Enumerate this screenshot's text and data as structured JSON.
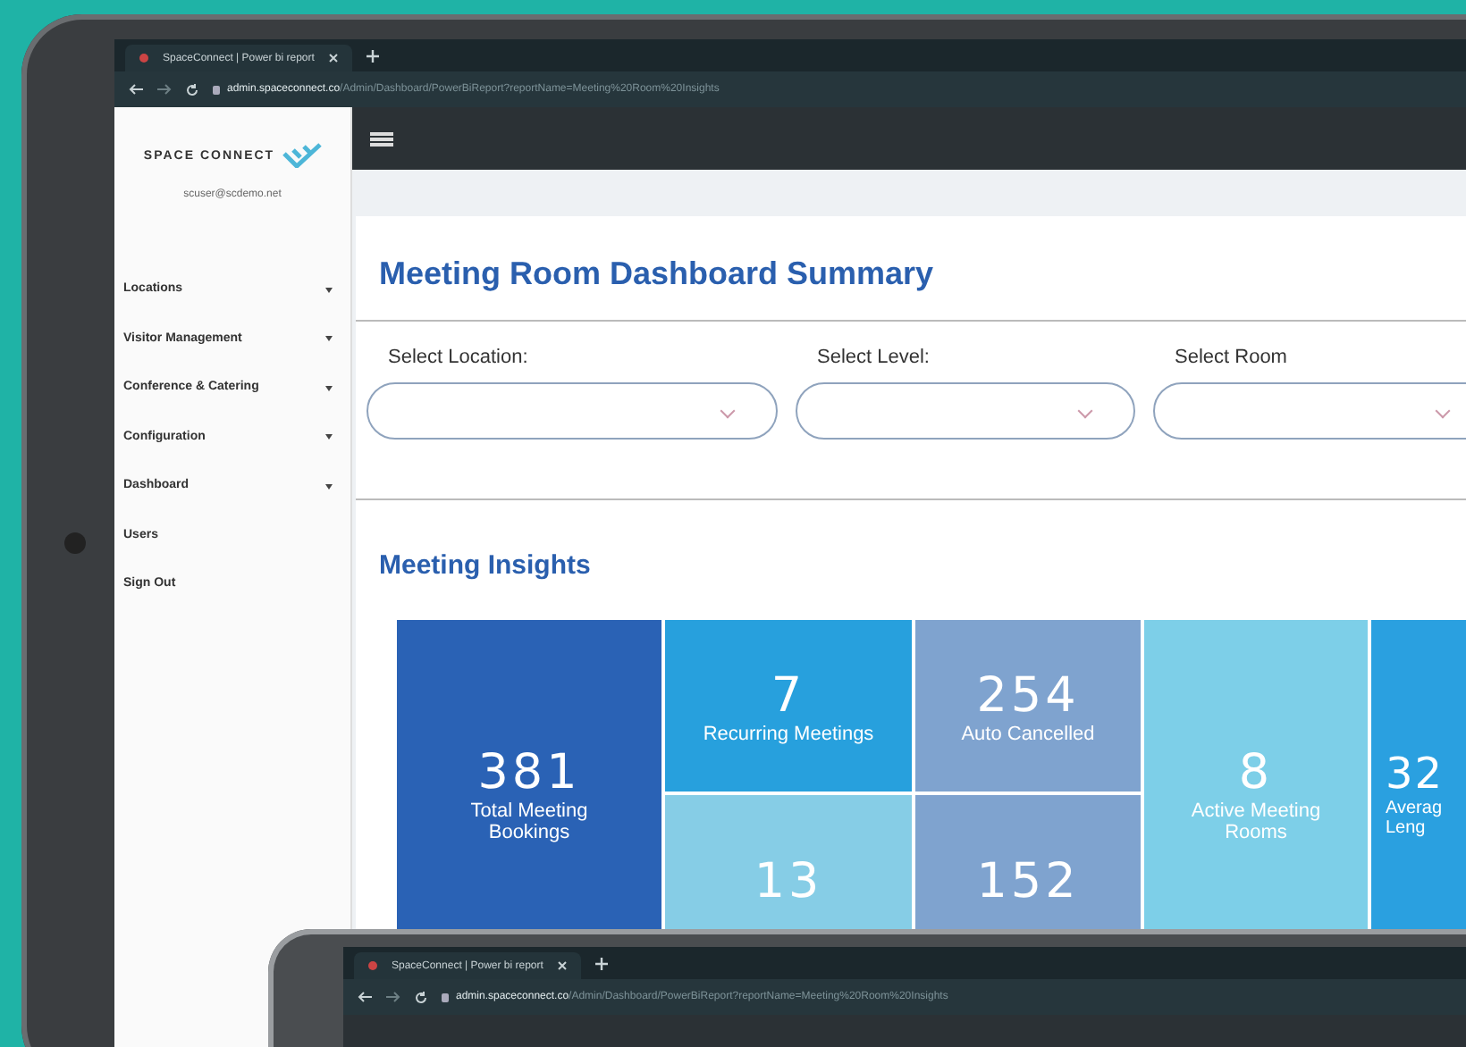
{
  "browser": {
    "tab_title": "SpaceConnect | Power bi report",
    "url_host": "admin.spaceconnect.co",
    "url_path": "/Admin/Dashboard/PowerBiReport?reportName=Meeting%20Room%20Insights"
  },
  "sidebar": {
    "brand": "SPACE CONNECT",
    "user": "scuser@scdemo.net",
    "items": [
      {
        "label": "Locations",
        "expandable": true
      },
      {
        "label": "Visitor Management",
        "expandable": true
      },
      {
        "label": "Conference & Catering",
        "expandable": true
      },
      {
        "label": "Configuration",
        "expandable": true
      },
      {
        "label": "Dashboard",
        "expandable": true
      },
      {
        "label": "Users",
        "expandable": false
      },
      {
        "label": "Sign Out",
        "expandable": false
      }
    ]
  },
  "page": {
    "title": "Meeting Room Dashboard Summary",
    "filters": [
      {
        "label": "Select Location:"
      },
      {
        "label": "Select Level:"
      },
      {
        "label": "Select Room"
      }
    ],
    "section_title": "Meeting Insights",
    "tiles": [
      {
        "value": "381",
        "label": "Total Meeting Bookings",
        "kind": "tall",
        "color": "#2a62b5"
      },
      {
        "value": "7",
        "label": "Recurring Meetings",
        "kind": "short",
        "color": "#27a0dd"
      },
      {
        "value": "254",
        "label": "Auto Cancelled",
        "kind": "short",
        "color": "#7fa3cf"
      },
      {
        "value": "8",
        "label": "Active Meeting Rooms",
        "kind": "tall",
        "color": "#7dcfe8"
      },
      {
        "value": "32",
        "label": "Averag Leng",
        "kind": "cut",
        "color": "#2aa0e0"
      },
      {
        "value": "13",
        "kind": "short",
        "color": "#86cde6"
      },
      {
        "value": "152",
        "kind": "short",
        "color": "#7fa3cf"
      }
    ]
  },
  "second_device": {
    "tab_title": "SpaceConnect | Power bi report",
    "url_host": "admin.spaceconnect.co",
    "url_path": "/Admin/Dashboard/PowerBiReport?reportName=Meeting%20Room%20Insights"
  }
}
